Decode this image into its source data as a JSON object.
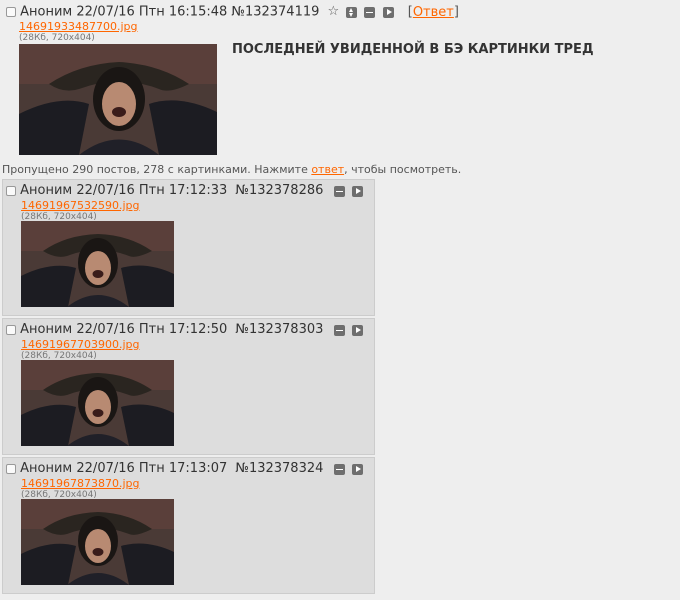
{
  "op": {
    "name": "Аноним",
    "datetime": "22/07/16 Птн 16:15:48",
    "post_num": "№132374119",
    "reply_open": "[",
    "reply_label": "Ответ",
    "reply_close": "]",
    "filename": "14691933487700.jpg",
    "filemeta": "(28Кб, 720x404)",
    "title": "ПОСЛЕДНЕЙ УВИДЕННОЙ В БЭ КАРТИНКИ ТРЕД"
  },
  "omitted": {
    "prefix": "Пропущено 290 постов, 278 с картинками. Нажмите ",
    "link": "ответ",
    "suffix": ", чтобы посмотреть."
  },
  "replies": [
    {
      "name": "Аноним",
      "datetime": "22/07/16 Птн 17:12:33",
      "post_num": "№132378286",
      "filename": "14691967532590.jpg",
      "filemeta": "(28Кб, 720x404)"
    },
    {
      "name": "Аноним",
      "datetime": "22/07/16 Птн 17:12:50",
      "post_num": "№132378303",
      "filename": "14691967703900.jpg",
      "filemeta": "(28Кб, 720x404)"
    },
    {
      "name": "Аноним",
      "datetime": "22/07/16 Птн 17:13:07",
      "post_num": "№132378324",
      "filename": "14691967873870.jpg",
      "filemeta": "(28Кб, 720x404)"
    }
  ],
  "colors": {
    "background": "#eeeeee",
    "post_background": "#dddddd",
    "link": "#ff6600",
    "text": "#333333"
  },
  "icons": {
    "favorite": "star-icon",
    "updown": "updown-icon",
    "hide": "hide-icon",
    "play": "play-icon"
  }
}
